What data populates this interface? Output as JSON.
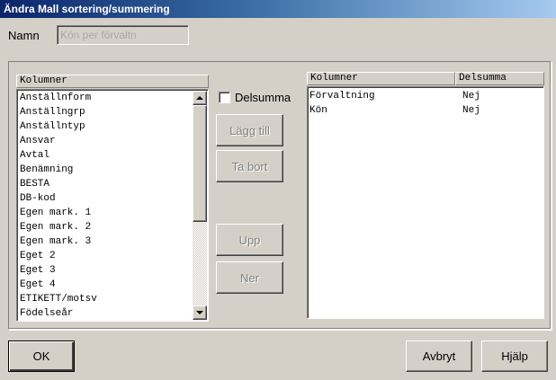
{
  "window": {
    "title": "Ändra Mall sortering/summering"
  },
  "name_field": {
    "label": "Namn",
    "value": "Kön per förvaltn"
  },
  "left_list": {
    "header": "Kolumner",
    "items": [
      "Anställnform",
      "Anställngrp",
      "Anställntyp",
      "Ansvar",
      "Avtal",
      "Benämning",
      "BESTA",
      "DB-kod",
      "Egen mark. 1",
      "Egen mark. 2",
      "Egen mark. 3",
      "Eget 2",
      "Eget 3",
      "Eget 4",
      "ETIKETT/motsv",
      "Födelseår"
    ]
  },
  "delsumma_checkbox": {
    "label": "Delsumma",
    "checked": false
  },
  "buttons": {
    "add": "Lägg till",
    "remove": "Ta bort",
    "up": "Upp",
    "down": "Ner",
    "ok": "OK",
    "cancel": "Avbryt",
    "help": "Hjälp"
  },
  "right_list": {
    "headers": [
      "Kolumner",
      "Delsumma"
    ],
    "rows": [
      {
        "column": "Förvaltning",
        "subtotal": "Nej"
      },
      {
        "column": "Kön",
        "subtotal": "Nej"
      }
    ]
  },
  "colors": {
    "titlebar_start": "#0a246a",
    "titlebar_end": "#a6caf0",
    "face": "#d4d0c8"
  }
}
